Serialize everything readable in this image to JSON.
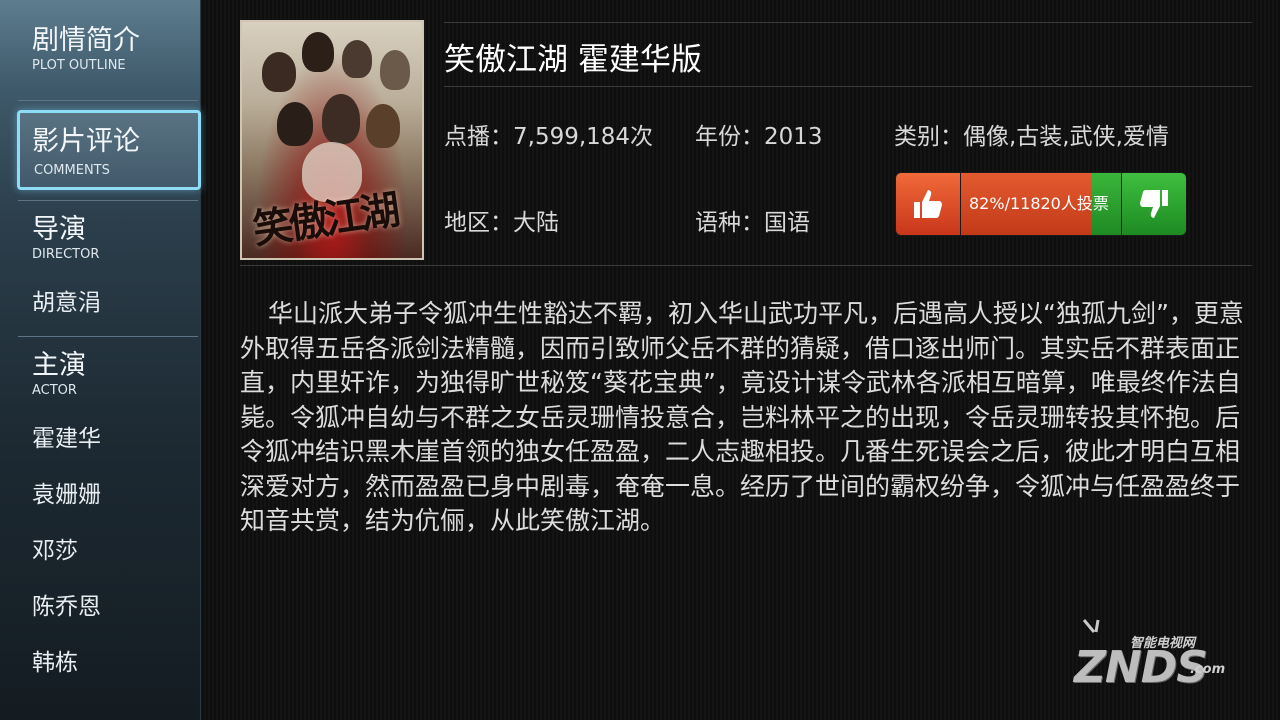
{
  "sidebar": {
    "plot": {
      "title": "剧情简介",
      "subtitle": "PLOT OUTLINE"
    },
    "comments": {
      "title": "影片评论",
      "subtitle": "COMMENTS"
    },
    "director": {
      "title": "导演",
      "subtitle": "DIRECTOR",
      "names": [
        "胡意涓"
      ]
    },
    "actor": {
      "title": "主演",
      "subtitle": "ACTOR",
      "names": [
        "霍建华",
        "袁姗姗",
        "邓莎",
        "陈乔恩",
        "韩栋"
      ]
    }
  },
  "poster": {
    "text": "笑傲江湖"
  },
  "detail": {
    "title": "笑傲江湖 霍建华版",
    "plays": "点播：7,599,184次",
    "year": "年份：2013",
    "genre": "类别：偶像,古装,武侠,爱情",
    "region": "地区：大陆",
    "language": "语种：国语",
    "vote": {
      "label": "82%/11820人投票",
      "up_ratio": 0.82,
      "up_icon": "thumbs-up-icon",
      "down_icon": "thumbs-down-icon"
    }
  },
  "description": "华山派大弟子令狐冲生性豁达不羁，初入华山武功平凡，后遇高人授以“独孤九剑”，更意外取得五岳各派剑法精髓，因而引致师父岳不群的猜疑，借口逐出师门。其实岳不群表面正直，内里奸诈，为独得旷世秘笈“葵花宝典”，竟设计谋令武林各派相互暗算，唯最终作法自毙。令狐冲自幼与不群之女岳灵珊情投意合，岂料林平之的出现，令岳灵珊转投其怀抱。后令狐冲结识黑木崖首领的独女任盈盈，二人志趣相投。几番生死误会之后，彼此才明白互相深爱对方，然而盈盈已身中剧毒，奄奄一息。经历了世间的霸权纷争，令狐冲与任盈盈终于知音共赏，结为伉俪，从此笑傲江湖。",
  "watermark": {
    "small": "智能电视网",
    "big": "ZNDS",
    "suffix": ".com"
  }
}
